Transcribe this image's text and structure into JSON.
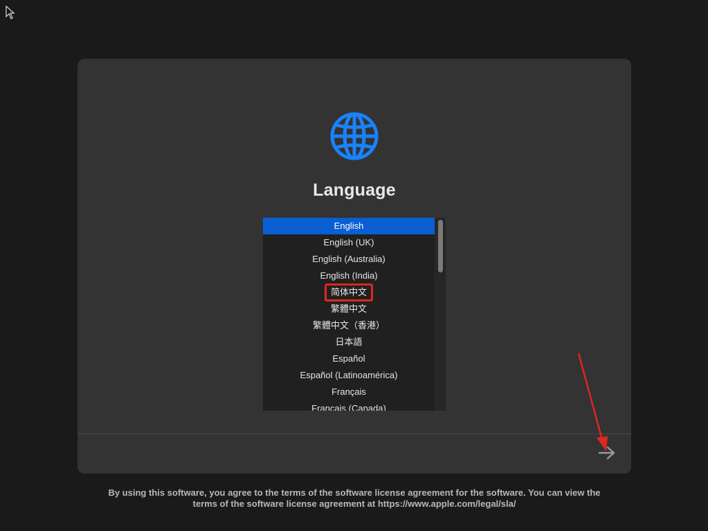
{
  "title": "Language",
  "languages": [
    {
      "label": "English",
      "selected": true
    },
    {
      "label": "English (UK)"
    },
    {
      "label": "English (Australia)"
    },
    {
      "label": "English (India)"
    },
    {
      "label": "简体中文",
      "highlighted": true
    },
    {
      "label": "繁體中文"
    },
    {
      "label": "繁體中文（香港）"
    },
    {
      "label": "日本語"
    },
    {
      "label": "Español"
    },
    {
      "label": "Español (Latinoamérica)"
    },
    {
      "label": "Français"
    },
    {
      "label": "Français (Canada)"
    }
  ],
  "footer": {
    "line1": "By using this software, you agree to the terms of the software license agreement for the software. You can view the",
    "line2": "terms of the software license agreement at https://www.apple.com/legal/sla/"
  },
  "icons": {
    "globe": "globe-icon",
    "next": "right-arrow-icon",
    "cursor": "mouse-pointer-icon"
  },
  "colors": {
    "accent": "#0a5fd3",
    "globe": "#1a82fb",
    "annotation": "#e0261f"
  }
}
